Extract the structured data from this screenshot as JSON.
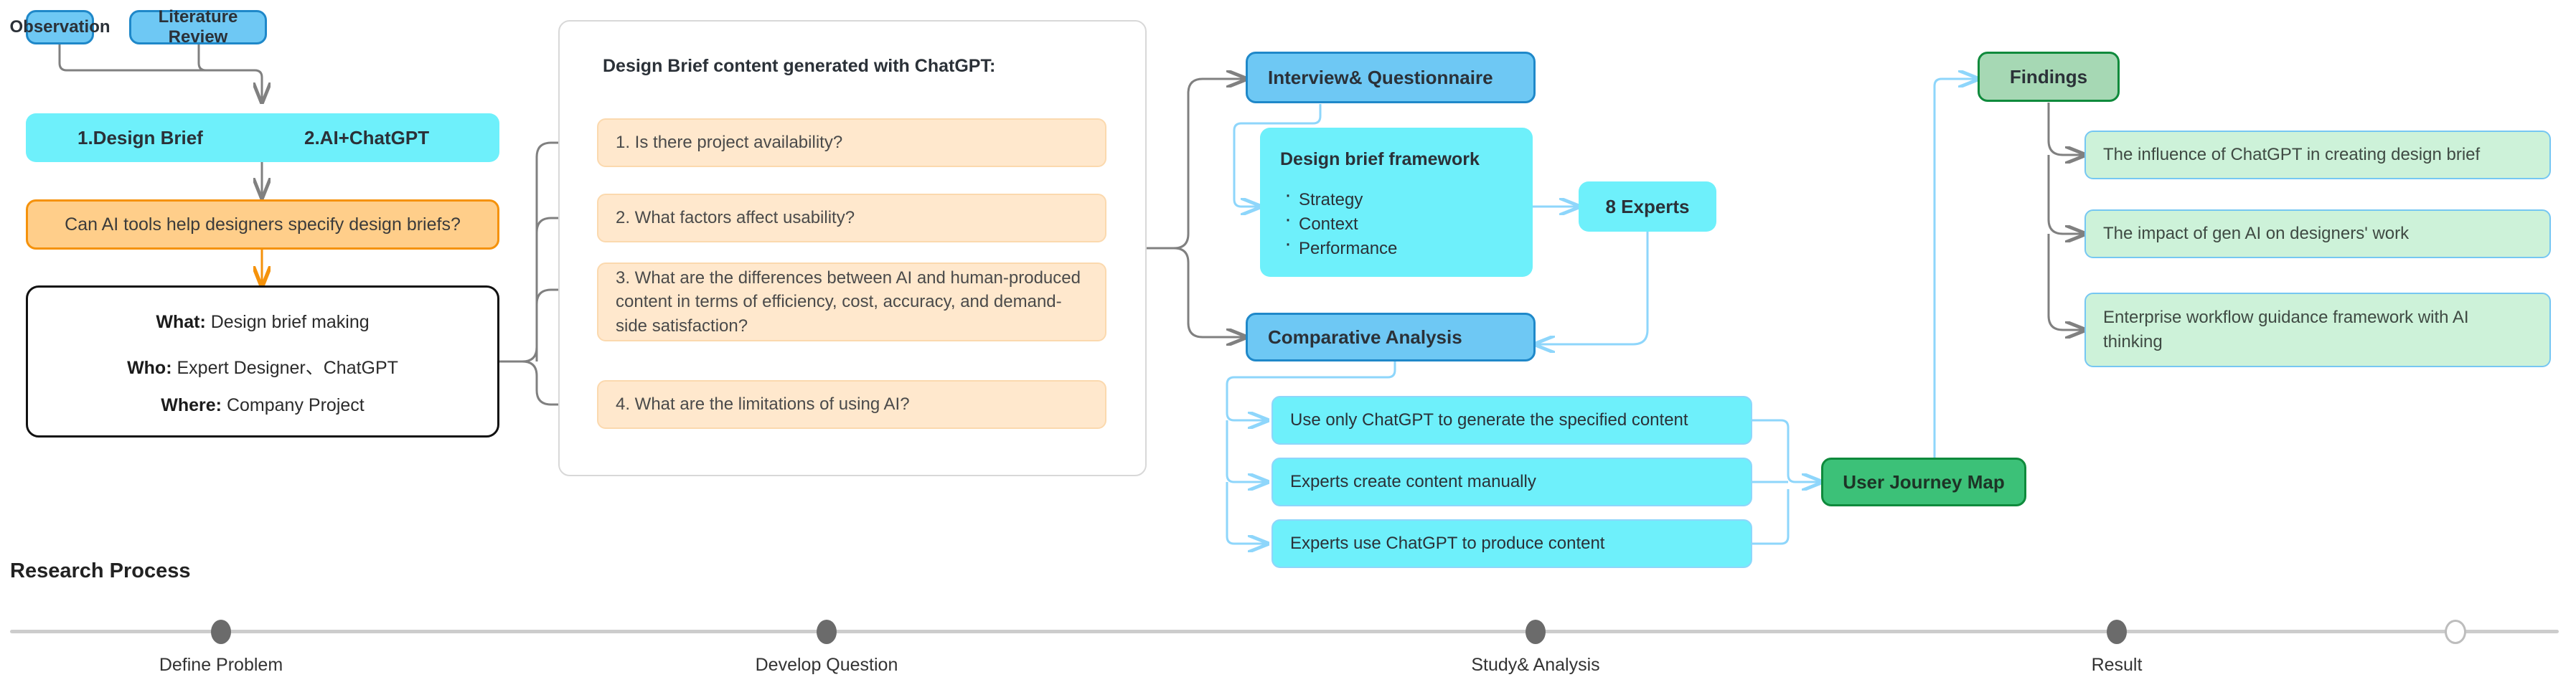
{
  "diagram": {
    "inputs": [
      {
        "label": "Observation"
      },
      {
        "label": "Literature Review"
      }
    ],
    "dual_bar": {
      "left_label": "1.Design Brief",
      "right_label": "2.AI+ChatGPT"
    },
    "research_question": "Can AI tools help designers specify design briefs?",
    "scope_box": {
      "what_label": "What:",
      "what_value": "Design brief making",
      "who_label": "Who:",
      "who_value": "Expert Designer、ChatGPT",
      "where_label": "Where:",
      "where_value": "Company Project"
    },
    "questions_panel": {
      "title": "Design Brief content generated with ChatGPT:",
      "items": [
        "1. Is there project availability?",
        "2. What factors affect usability?",
        "3. What are the differences between AI and human-produced content in terms of efficiency, cost, accuracy, and demand-side satisfaction?",
        "4. What are the limitations of using AI?"
      ]
    },
    "methods": {
      "interview": "Interview& Questionnaire",
      "comparative": "Comparative Analysis"
    },
    "framework": {
      "title": "Design brief framework",
      "bullets": [
        "Strategy",
        "Context",
        "Performance"
      ]
    },
    "experts": "8 Experts",
    "conditions": [
      "Use only ChatGPT to generate the specified content",
      "Experts create content manually",
      "Experts use ChatGPT to produce content"
    ],
    "user_journey_map": "User Journey Map",
    "findings": {
      "title": "Findings",
      "items": [
        "The influence of ChatGPT in creating design brief",
        "The impact of gen AI on designers' work",
        "Enterprise workflow guidance framework with AI thinking"
      ]
    }
  },
  "timeline": {
    "title": "Research Process",
    "stages": [
      {
        "label": "Define Problem"
      },
      {
        "label": "Develop Question"
      },
      {
        "label": "Study& Analysis"
      },
      {
        "label": "Result"
      }
    ]
  },
  "colors": {
    "blue_fill": "#6ec8f4",
    "blue_border": "#1f88c9",
    "cyan_fill": "#6ef0fb",
    "orange_fill": "#ffce8a",
    "orange_border": "#f5920b",
    "peach_fill": "#ffe8cd",
    "green_pale_fill": "#a6d8b4",
    "green_strong_fill": "#3cc178",
    "green_border": "#0f8a3c",
    "green_soft_fill": "#cdf2d9",
    "wire_gray": "#808080",
    "wire_blue": "#8ed6fb"
  }
}
